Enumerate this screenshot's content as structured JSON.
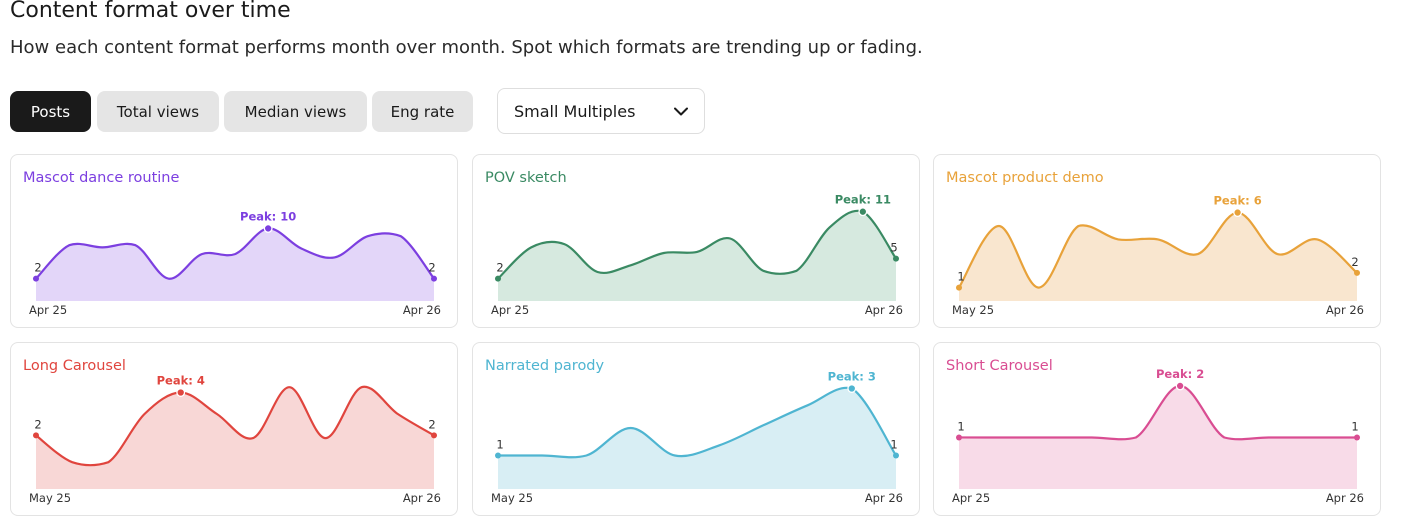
{
  "header": {
    "title": "Content format over time",
    "subtitle": "How each content format performs month over month. Spot which formats are trending up or fading."
  },
  "tabs": [
    {
      "label": "Posts",
      "active": true
    },
    {
      "label": "Total views",
      "active": false
    },
    {
      "label": "Median views",
      "active": false
    },
    {
      "label": "Eng rate",
      "active": false
    }
  ],
  "view_select": {
    "value": "Small Multiples",
    "icon": "chevron-down-icon"
  },
  "chart_data": [
    {
      "type": "area",
      "title": "Mascot dance routine",
      "color": "#7c3fe0",
      "fill": "#e3d6f9",
      "x_start": "Apr 25",
      "x_end": "Apr 26",
      "values": [
        2,
        5,
        4.8,
        5,
        2,
        4.2,
        4.2,
        6.5,
        4.7,
        3.9,
        5.8,
        5.8,
        2
      ],
      "ylim": [
        0,
        12
      ],
      "peak": {
        "index": 7,
        "label": "Peak: 10"
      },
      "start_label": "2",
      "end_label": "2"
    },
    {
      "type": "area",
      "title": "POV sketch",
      "color": "#3a8a63",
      "fill": "#d6e9df",
      "x_start": "Apr 25",
      "x_end": "Apr 26",
      "values": [
        2,
        4.8,
        5.1,
        2.6,
        3.2,
        4.3,
        4.4,
        5.6,
        2.7,
        2.7,
        6.6,
        8.0,
        3.8
      ],
      "ylim": [
        0,
        12
      ],
      "peak": {
        "index": 11,
        "label": "Peak: 11"
      },
      "start_label": "2",
      "end_label": "5"
    },
    {
      "type": "area",
      "title": "Mascot product demo",
      "color": "#e8a23a",
      "fill": "#f9e6cf",
      "x_start": "May 25",
      "x_end": "Apr 26",
      "values": [
        1,
        5.6,
        1,
        5.6,
        4.6,
        4.6,
        3.5,
        6.6,
        3.5,
        4.6,
        2.1
      ],
      "ylim": [
        0,
        10
      ],
      "peak": {
        "index": 7,
        "label": "Peak: 6"
      },
      "start_label": "1",
      "end_label": "2"
    },
    {
      "type": "area",
      "title": "Long Carousel",
      "color": "#e0453e",
      "fill": "#f8d7d6",
      "x_start": "May 25",
      "x_end": "Apr 26",
      "values": [
        2,
        1,
        1,
        2.8,
        3.6,
        2.8,
        1.9,
        3.8,
        1.9,
        3.8,
        2.8,
        2
      ],
      "ylim": [
        0,
        5
      ],
      "peak": {
        "index": 4,
        "label": "Peak: 4"
      },
      "start_label": "2",
      "end_label": "2"
    },
    {
      "type": "area",
      "title": "Narrated parody",
      "color": "#4fb5d1",
      "fill": "#d8eef4",
      "x_start": "May 25",
      "x_end": "Apr 26",
      "values": [
        1,
        1,
        1,
        1.82,
        1,
        1.3,
        1.9,
        2.5,
        3,
        1
      ],
      "ylim": [
        0,
        4
      ],
      "peak": {
        "index": 8,
        "label": "Peak: 3"
      },
      "start_label": "1",
      "end_label": "1"
    },
    {
      "type": "area",
      "title": "Short Carousel",
      "color": "#d94d92",
      "fill": "#f8dbe8",
      "x_start": "Apr 25",
      "x_end": "Apr 26",
      "values": [
        1,
        1,
        1,
        1,
        1,
        2,
        1,
        1,
        1,
        1
      ],
      "ylim": [
        0,
        2.6
      ],
      "peak": {
        "index": 5,
        "label": "Peak: 2"
      },
      "start_label": "1",
      "end_label": "1"
    }
  ]
}
